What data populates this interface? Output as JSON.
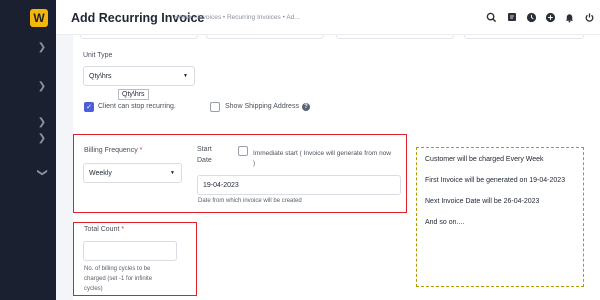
{
  "app": {
    "logo_letter": "W"
  },
  "header": {
    "title": "Add Recurring Invoice",
    "breadcrumb": "Home • Invoices • Recurring Invoices • Ad..."
  },
  "form": {
    "unit_type": {
      "label": "Unit Type",
      "value": "Qty\\hrs",
      "tooltip": "Qty\\hrs"
    },
    "client_stop": {
      "label": "Client can stop recurring.",
      "checked": true
    },
    "shipping": {
      "label": "Show Shipping Address",
      "checked": false
    },
    "billing_frequency": {
      "label": "Billing Frequency",
      "required_mark": "*",
      "value": "Weekly"
    },
    "start_date": {
      "label_line1": "Start",
      "label_line2": "Date",
      "immediate_label_line1": "Immediate start ( Invoice will generate from now",
      "immediate_label_line2": ")",
      "immediate_checked": false,
      "value": "19-04-2023",
      "hint": "Date from which invoice will be created"
    },
    "total_count": {
      "label": "Total Count",
      "required_mark": "*",
      "value": "",
      "hint_line1": "No. of billing cycles to be",
      "hint_line2": "charged (set -1 for infinite",
      "hint_line3": "cycles)"
    }
  },
  "info": {
    "line1": "Customer will be charged Every Week",
    "line2": "First Invoice will be generated on 19-04-2023",
    "line3": "Next Invoice Date will be 26-04-2023",
    "line4": "And so on...."
  },
  "colors": {
    "accent": "#4c5fd5",
    "logo": "#f5b60a",
    "sidebar": "#1b2030",
    "highlight_red": "#e0202b",
    "highlight_yellow": "#b39a05"
  },
  "icons": [
    "search-icon",
    "notes-icon",
    "clock-icon",
    "plus-circle-icon",
    "bell-icon",
    "power-icon",
    "chevron-right-icon",
    "chevron-down-icon",
    "help-icon"
  ]
}
